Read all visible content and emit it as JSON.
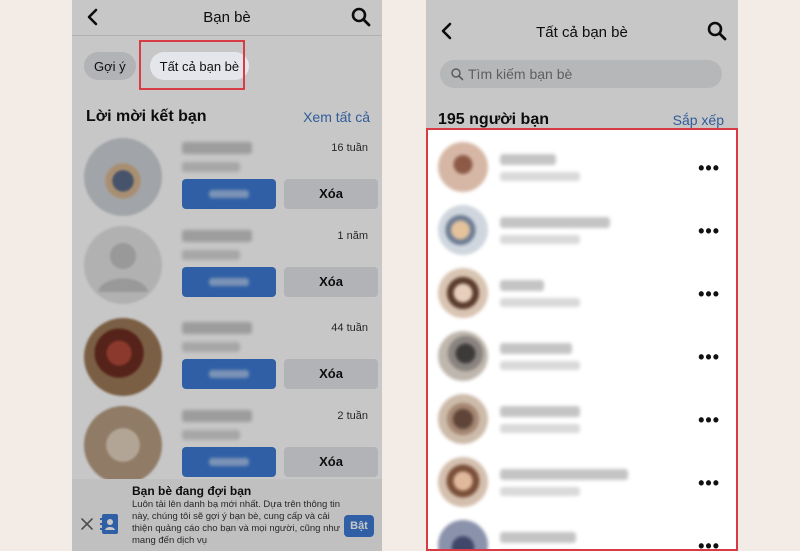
{
  "left": {
    "header": {
      "title": "Bạn bè",
      "back_icon": "chevron-left-icon",
      "search_icon": "search-icon"
    },
    "chips": [
      {
        "label": "Gợi ý"
      },
      {
        "label": "Tất cả bạn bè"
      }
    ],
    "requests_section": {
      "title": "Lời mời kết bạn",
      "see_all": "Xem tất cả"
    },
    "requests": [
      {
        "time": "16 tuần",
        "delete_label": "Xóa"
      },
      {
        "time": "1 năm",
        "delete_label": "Xóa"
      },
      {
        "time": "44 tuần",
        "delete_label": "Xóa"
      },
      {
        "time": "2 tuần",
        "delete_label": "Xóa"
      }
    ],
    "banner": {
      "title": "Bạn bè đang đợi bạn",
      "text": "Luôn tải lên danh bạ mới nhất. Dựa trên thông tin này, chúng tôi sẽ gợi ý bạn bè, cung cấp và cải thiện quảng cáo cho bạn và mọi người, cũng như mang đến dịch vụ",
      "button": "Bật"
    }
  },
  "right": {
    "header": {
      "title": "Tất cả bạn bè",
      "back_icon": "chevron-left-icon",
      "search_icon": "search-icon"
    },
    "search": {
      "placeholder": "Tìm kiếm bạn bè"
    },
    "friends_count": "195 người bạn",
    "sort_label": "Sắp xếp",
    "friends": [
      {
        "more": "•••"
      },
      {
        "more": "•••"
      },
      {
        "more": "•••"
      },
      {
        "more": "•••"
      },
      {
        "more": "•••"
      },
      {
        "more": "•••"
      },
      {
        "more": "•••"
      }
    ]
  },
  "colors": {
    "accent": "#3e7ad4",
    "highlight": "#d83b43",
    "link": "#3f76c4"
  }
}
